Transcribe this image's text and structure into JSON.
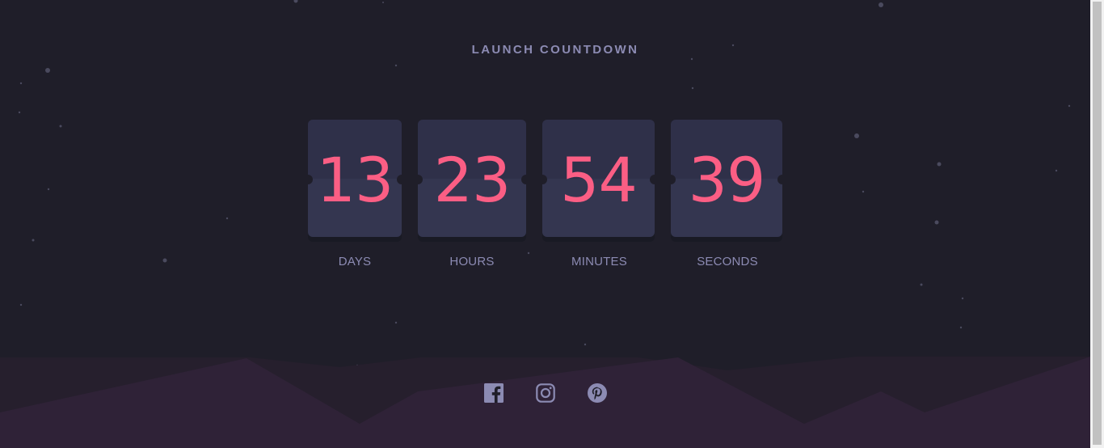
{
  "header": {
    "title": "LAUNCH COUNTDOWN"
  },
  "countdown": {
    "units": [
      {
        "value": "13",
        "label": "DAYS"
      },
      {
        "value": "23",
        "label": "HOURS"
      },
      {
        "value": "54",
        "label": "MINUTES"
      },
      {
        "value": "39",
        "label": "SECONDS"
      }
    ]
  },
  "footer": {
    "social_links": [
      {
        "icon": "facebook-icon"
      },
      {
        "icon": "instagram-icon"
      },
      {
        "icon": "pinterest-icon"
      }
    ]
  },
  "colors": {
    "background": "#1f1e29",
    "card": "#343650",
    "accent": "#fb5e84",
    "muted_text": "#8c8bb3",
    "hills": "#2f2237"
  }
}
